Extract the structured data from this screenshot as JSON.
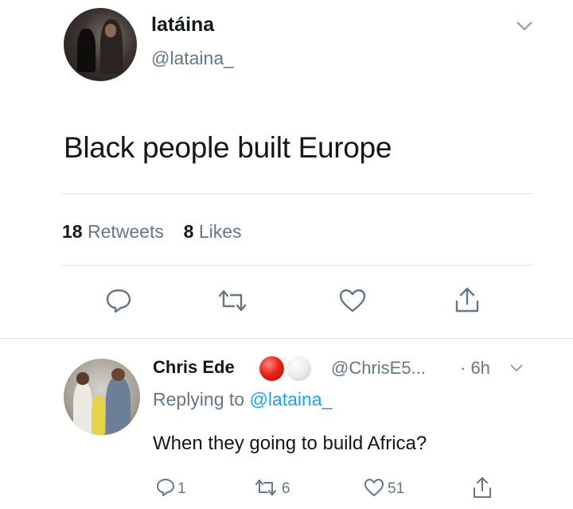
{
  "tweet": {
    "display_name": "latáina",
    "handle": "@lataina_",
    "text": "Black people built Europe",
    "retweets_count": "18",
    "retweets_label": "Retweets",
    "likes_count": "8",
    "likes_label": "Likes",
    "actions": [
      "reply-icon",
      "retweet-icon",
      "like-icon",
      "share-icon"
    ]
  },
  "reply": {
    "display_name": "Chris Ede",
    "emojis": [
      "red-circle-emoji",
      "white-circle-emoji"
    ],
    "handle": "@ChrisE5...",
    "time": "· 6h",
    "replying_prefix": "Replying to ",
    "replying_mention": "@lataina_",
    "text": "When they going to build Africa?",
    "reply_count": "1",
    "retweet_count": "6",
    "like_count": "51"
  },
  "colors": {
    "text_primary": "#14171a",
    "text_secondary": "#657786",
    "link": "#1da1f2",
    "divider": "#e3e6e8"
  }
}
